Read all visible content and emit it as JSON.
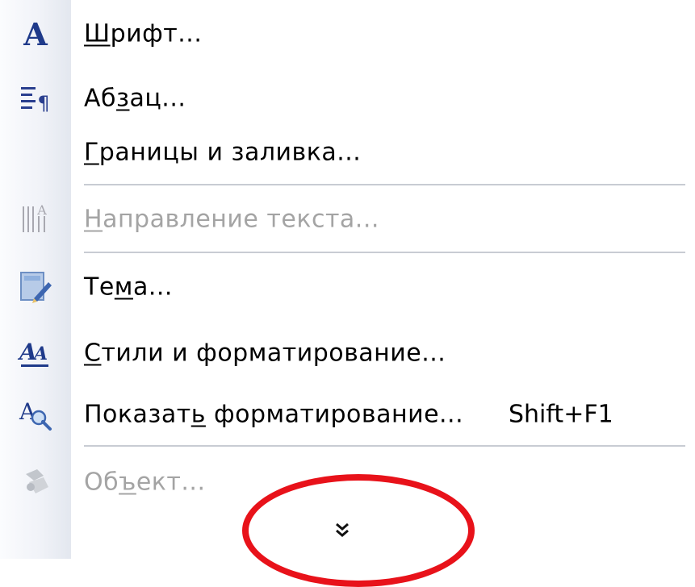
{
  "menu": {
    "items": [
      {
        "icon": "font-icon",
        "pre": "",
        "ul": "Ш",
        "post": "рифт...",
        "disabled": false
      },
      {
        "icon": "paragraph-icon",
        "pre": "Аб",
        "ul": "з",
        "post": "ац...",
        "disabled": false
      },
      {
        "icon": "",
        "pre": "",
        "ul": "Г",
        "post": "раницы и заливка...",
        "disabled": false
      },
      {
        "icon": "text-direction-icon",
        "pre": "",
        "ul": "Н",
        "post": "аправление текста...",
        "disabled": true
      },
      {
        "icon": "theme-icon",
        "pre": "Те",
        "ul": "м",
        "post": "а...",
        "disabled": false
      },
      {
        "icon": "styles-icon",
        "pre": "",
        "ul": "С",
        "post": "тили и форматирование...",
        "disabled": false
      },
      {
        "icon": "reveal-formatting-icon",
        "pre": "Показат",
        "ul": "ь",
        "post": " форматирование...",
        "shortcut": "Shift+F1",
        "disabled": false
      },
      {
        "icon": "object-icon",
        "pre": "Об",
        "ul": "ъ",
        "post": "ект...",
        "disabled": true
      }
    ],
    "expand_icon": "double-chevron-down-icon"
  },
  "colors": {
    "annotation": "#e8121a",
    "disabled_text": "#a4a4a4",
    "separator": "#c8ccd3"
  }
}
